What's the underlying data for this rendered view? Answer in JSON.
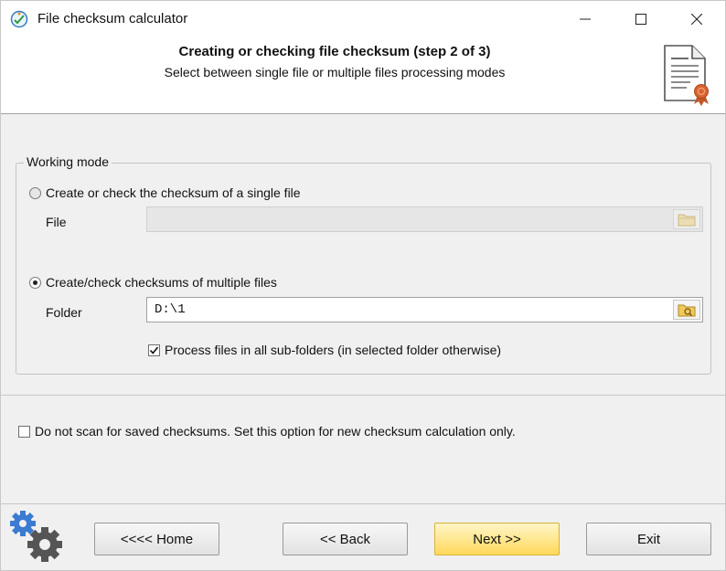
{
  "window": {
    "title": "File checksum calculator"
  },
  "header": {
    "step_title": "Creating or checking file checksum (step 2 of 3)",
    "step_subtitle": "Select between single file or multiple files processing modes"
  },
  "working_mode": {
    "legend": "Working mode",
    "single_file": {
      "label": "Create or check the checksum of a single file",
      "selected": false,
      "field_label": "File",
      "value": ""
    },
    "multiple_files": {
      "label": "Create/check checksums of multiple files",
      "selected": true,
      "field_label": "Folder",
      "value": "D:\\1",
      "subfolders_label": "Process files in all sub-folders (in selected folder otherwise)",
      "subfolders_checked": true
    }
  },
  "options": {
    "no_scan_label": "Do not scan for saved checksums. Set this option for new checksum calculation only.",
    "no_scan_checked": false
  },
  "buttons": {
    "home": "<<<< Home",
    "back": "<< Back",
    "next": "Next >>",
    "exit": "Exit"
  },
  "icons": {
    "app": "checksum-app-icon",
    "header": "certificate-document-icon",
    "file_browse": "folder-icon",
    "folder_browse": "folder-search-icon",
    "settings": "gear-icon"
  },
  "colors": {
    "next_button": "#ffd85a",
    "accent_blue": "#2b6fc2"
  }
}
